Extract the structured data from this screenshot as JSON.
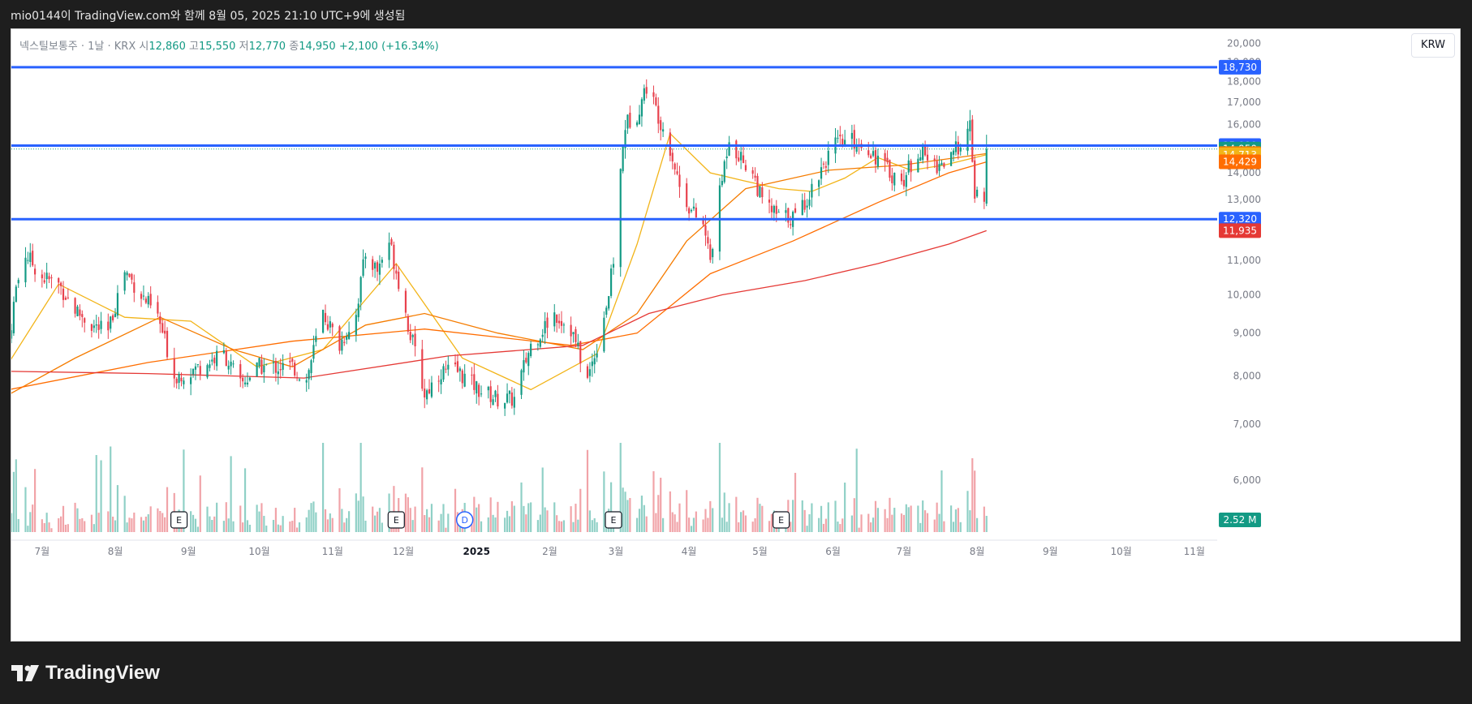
{
  "caption": "mio0144이 TradingView.com와 함께 8월 05, 2025 21:10 UTC+9에 생성됨",
  "legend": {
    "symbol": "넥스틸보통주 · 1날 · KRX",
    "open_label": "시",
    "open": "12,860",
    "high_label": "고",
    "high": "15,550",
    "low_label": "저",
    "low": "12,770",
    "close_label": "종",
    "close": "14,950",
    "change": "+2,100 (+16.34%)"
  },
  "currency": "KRW",
  "brand": {
    "name": "TradingView",
    "icon": "tradingview-logo-icon"
  },
  "colors": {
    "up": "#139a84",
    "down": "#e8414d",
    "hline": "#2962ff",
    "ma_short": "#f2b418",
    "ma_mid": "#f57c00",
    "ma_long": "#e53935",
    "vol_up": "#8fd0c6",
    "vol_down": "#f1a3a8"
  },
  "chart_data": {
    "type": "candlestick",
    "x_labels": [
      "7월",
      "8월",
      "9월",
      "10월",
      "11월",
      "12월",
      "2025",
      "2월",
      "3월",
      "4월",
      "5월",
      "6월",
      "7월",
      "8월",
      "9월",
      "10월",
      "11월"
    ],
    "x_range": [
      "2024-06-18",
      "2025-11-10"
    ],
    "y_ticks": [
      "20,000",
      "19,000",
      "18,000",
      "17,000",
      "16,000",
      "15,000",
      "14,000",
      "13,000",
      "12,000",
      "11,000",
      "10,000",
      "9,000",
      "8,000",
      "7,000",
      "6,000"
    ],
    "ylim": [
      5200,
      20800
    ],
    "y_scale": "log",
    "horizontal_lines": [
      {
        "value": 18730,
        "label": "18,730"
      },
      {
        "value": 15090,
        "label": "15,090"
      },
      {
        "value": 12320,
        "label": "12,320"
      }
    ],
    "price_labels": [
      {
        "value": 14950,
        "label": "14,950",
        "color": "#139a84"
      },
      {
        "value": 14762,
        "label": "14,762",
        "color": "#f57c00"
      },
      {
        "value": 14713,
        "label": "14,713",
        "color": "#f2b418"
      },
      {
        "value": 14429,
        "label": "14,429",
        "color": "#ff6d00"
      },
      {
        "value": 11935,
        "label": "11,935",
        "color": "#e53935"
      }
    ],
    "volume_label": "2.52 M",
    "events": [
      {
        "type": "E",
        "date": "2024-08-28"
      },
      {
        "type": "E",
        "date": "2024-11-28"
      },
      {
        "type": "D",
        "date": "2024-12-27"
      },
      {
        "type": "E",
        "date": "2025-02-28"
      },
      {
        "type": "E",
        "date": "2025-05-10"
      }
    ],
    "price_path": [
      [
        "2024-06-17",
        8800
      ],
      [
        "2024-06-20",
        10200
      ],
      [
        "2024-06-24",
        11200
      ],
      [
        "2024-07-01",
        10500
      ],
      [
        "2024-07-08",
        10300
      ],
      [
        "2024-07-15",
        9600
      ],
      [
        "2024-07-22",
        9200
      ],
      [
        "2024-07-29",
        9000
      ],
      [
        "2024-08-05",
        10700
      ],
      [
        "2024-08-12",
        10000
      ],
      [
        "2024-08-19",
        9400
      ],
      [
        "2024-08-26",
        8000
      ],
      [
        "2024-09-02",
        8100
      ],
      [
        "2024-09-09",
        8300
      ],
      [
        "2024-09-16",
        8500
      ],
      [
        "2024-09-23",
        7800
      ],
      [
        "2024-10-01",
        8200
      ],
      [
        "2024-10-15",
        8200
      ],
      [
        "2024-10-21",
        7900
      ],
      [
        "2024-10-28",
        9500
      ],
      [
        "2024-11-04",
        8700
      ],
      [
        "2024-11-11",
        9500
      ],
      [
        "2024-11-15",
        11200
      ],
      [
        "2024-11-20",
        10700
      ],
      [
        "2024-11-25",
        11600
      ],
      [
        "2024-11-29",
        10400
      ],
      [
        "2024-12-03",
        9200
      ],
      [
        "2024-12-10",
        7600
      ],
      [
        "2024-12-17",
        8100
      ],
      [
        "2024-12-24",
        8100
      ],
      [
        "2025-01-02",
        7700
      ],
      [
        "2025-01-10",
        7500
      ],
      [
        "2025-01-17",
        7500
      ],
      [
        "2025-01-24",
        8700
      ],
      [
        "2025-02-03",
        9500
      ],
      [
        "2025-02-10",
        9100
      ],
      [
        "2025-02-17",
        7900
      ],
      [
        "2025-02-21",
        8700
      ],
      [
        "2025-02-26",
        10000
      ],
      [
        "2025-02-28",
        11000
      ],
      [
        "2025-03-03",
        14000
      ],
      [
        "2025-03-05",
        16000
      ],
      [
        "2025-03-10",
        16500
      ],
      [
        "2025-03-14",
        17800
      ],
      [
        "2025-03-18",
        16700
      ],
      [
        "2025-03-24",
        15000
      ],
      [
        "2025-03-28",
        13500
      ],
      [
        "2025-04-02",
        12600
      ],
      [
        "2025-04-07",
        12100
      ],
      [
        "2025-04-10",
        11000
      ],
      [
        "2025-04-14",
        13200
      ],
      [
        "2025-04-18",
        15500
      ],
      [
        "2025-04-22",
        14700
      ],
      [
        "2025-04-28",
        14000
      ],
      [
        "2025-05-02",
        12900
      ],
      [
        "2025-05-09",
        12400
      ],
      [
        "2025-05-16",
        12400
      ],
      [
        "2025-05-22",
        13200
      ],
      [
        "2025-05-28",
        14400
      ],
      [
        "2025-06-02",
        15100
      ],
      [
        "2025-06-09",
        15300
      ],
      [
        "2025-06-16",
        15000
      ],
      [
        "2025-06-23",
        14200
      ],
      [
        "2025-06-30",
        13600
      ],
      [
        "2025-07-07",
        14900
      ],
      [
        "2025-07-14",
        14300
      ],
      [
        "2025-07-21",
        14500
      ],
      [
        "2025-07-25",
        15300
      ],
      [
        "2025-07-29",
        15800
      ],
      [
        "2025-07-31",
        13200
      ],
      [
        "2025-08-04",
        12860
      ],
      [
        "2025-08-05",
        14950
      ]
    ],
    "moving_averages": [
      {
        "color": "#f2b418",
        "points": [
          [
            "2024-06-17",
            8300
          ],
          [
            "2024-07-08",
            10300
          ],
          [
            "2024-08-05",
            9400
          ],
          [
            "2024-09-02",
            9300
          ],
          [
            "2024-09-30",
            8200
          ],
          [
            "2024-10-28",
            8600
          ],
          [
            "2024-11-28",
            10900
          ],
          [
            "2024-12-26",
            8400
          ],
          [
            "2025-01-24",
            7700
          ],
          [
            "2025-02-21",
            8500
          ],
          [
            "2025-03-10",
            11500
          ],
          [
            "2025-03-24",
            15600
          ],
          [
            "2025-04-10",
            14000
          ],
          [
            "2025-04-24",
            13700
          ],
          [
            "2025-05-09",
            13400
          ],
          [
            "2025-05-23",
            13300
          ],
          [
            "2025-06-06",
            13800
          ],
          [
            "2025-06-20",
            14600
          ],
          [
            "2025-07-04",
            14100
          ],
          [
            "2025-07-18",
            14300
          ],
          [
            "2025-08-05",
            14713
          ]
        ]
      },
      {
        "color": "#f57c00",
        "points": [
          [
            "2024-06-17",
            7600
          ],
          [
            "2024-07-15",
            8400
          ],
          [
            "2024-08-20",
            9400
          ],
          [
            "2024-09-20",
            8600
          ],
          [
            "2024-10-15",
            8200
          ],
          [
            "2024-11-15",
            9200
          ],
          [
            "2024-12-10",
            9500
          ],
          [
            "2025-01-10",
            9000
          ],
          [
            "2025-02-15",
            8600
          ],
          [
            "2025-03-10",
            9500
          ],
          [
            "2025-03-31",
            11600
          ],
          [
            "2025-04-25",
            13400
          ],
          [
            "2025-05-30",
            14100
          ],
          [
            "2025-06-30",
            14300
          ],
          [
            "2025-08-05",
            14762
          ]
        ]
      },
      {
        "color": "#ff6d00",
        "points": [
          [
            "2024-06-17",
            7700
          ],
          [
            "2024-08-15",
            8300
          ],
          [
            "2024-10-15",
            8800
          ],
          [
            "2024-12-10",
            9100
          ],
          [
            "2025-02-10",
            8700
          ],
          [
            "2025-03-10",
            9000
          ],
          [
            "2025-04-10",
            10600
          ],
          [
            "2025-05-15",
            11600
          ],
          [
            "2025-06-20",
            12900
          ],
          [
            "2025-07-20",
            14000
          ],
          [
            "2025-08-05",
            14429
          ]
        ]
      },
      {
        "color": "#e53935",
        "points": [
          [
            "2024-06-17",
            8100
          ],
          [
            "2024-08-15",
            8050
          ],
          [
            "2024-10-20",
            7950
          ],
          [
            "2024-12-20",
            8450
          ],
          [
            "2025-02-15",
            8700
          ],
          [
            "2025-03-15",
            9500
          ],
          [
            "2025-04-15",
            10000
          ],
          [
            "2025-05-20",
            10400
          ],
          [
            "2025-06-20",
            10900
          ],
          [
            "2025-07-20",
            11500
          ],
          [
            "2025-08-05",
            11935
          ]
        ]
      }
    ]
  }
}
